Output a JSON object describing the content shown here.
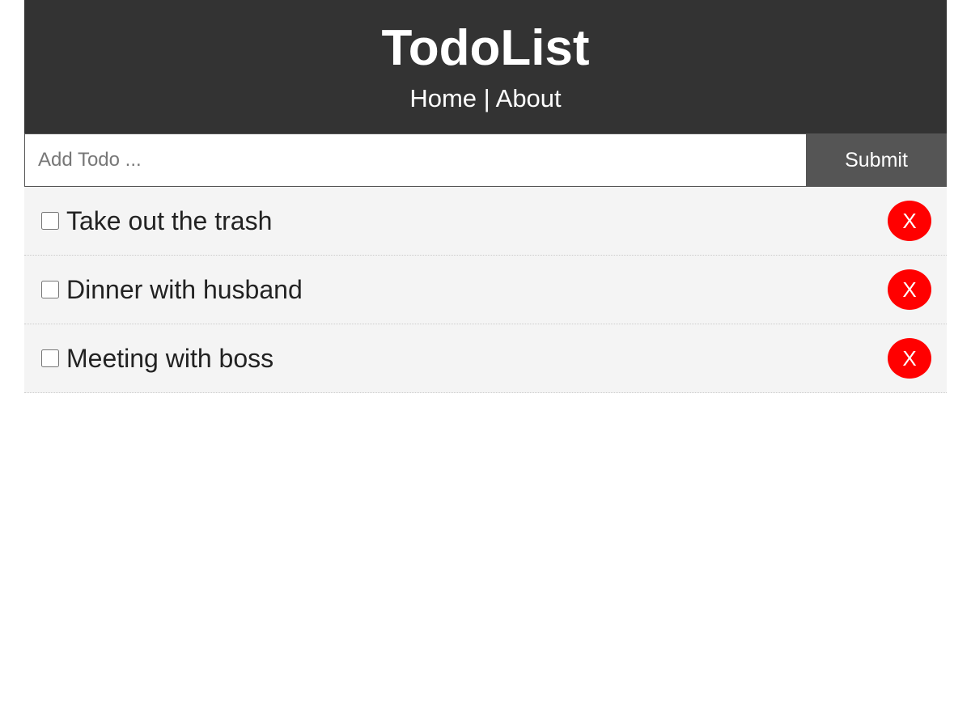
{
  "header": {
    "title": "TodoList",
    "nav": {
      "home": "Home",
      "separator": "|",
      "about": "About"
    }
  },
  "form": {
    "placeholder": "Add Todo ...",
    "value": "",
    "submit_label": "Submit"
  },
  "todos": [
    {
      "title": "Take out the trash",
      "completed": false,
      "delete_label": "X"
    },
    {
      "title": "Dinner with husband",
      "completed": false,
      "delete_label": "X"
    },
    {
      "title": "Meeting with boss",
      "completed": false,
      "delete_label": "X"
    }
  ],
  "colors": {
    "header_bg": "#333333",
    "submit_bg": "#555555",
    "item_bg": "#f4f4f4",
    "delete_bg": "#ff0000"
  }
}
